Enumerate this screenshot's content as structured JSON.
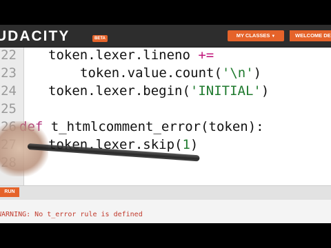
{
  "header": {
    "logo_text": "UDACITY",
    "beta_label": "BETA",
    "my_classes_label": "MY CLASSES",
    "welcome_label": "WELCOME DE"
  },
  "editor": {
    "lines": [
      {
        "number": "22",
        "code": "token.lexer.lineno += "
      },
      {
        "number": "23",
        "code": "token.value.count('\\n')"
      },
      {
        "number": "24",
        "code": "token.lexer.begin('INITIAL')"
      },
      {
        "number": "25",
        "code": ""
      },
      {
        "number": "26",
        "code": "def t_htmlcomment_error(token):"
      },
      {
        "number": "27",
        "code": "token.lexer.skip(1)"
      },
      {
        "number": "28",
        "code": ""
      }
    ]
  },
  "run_label": "RUN",
  "output_text": "WARNING: No t_error rule is defined",
  "colors": {
    "accent": "#e5632a",
    "keyword": "#b2357c",
    "string": "#1f7a2e",
    "header_bg": "#2d2d2d"
  }
}
